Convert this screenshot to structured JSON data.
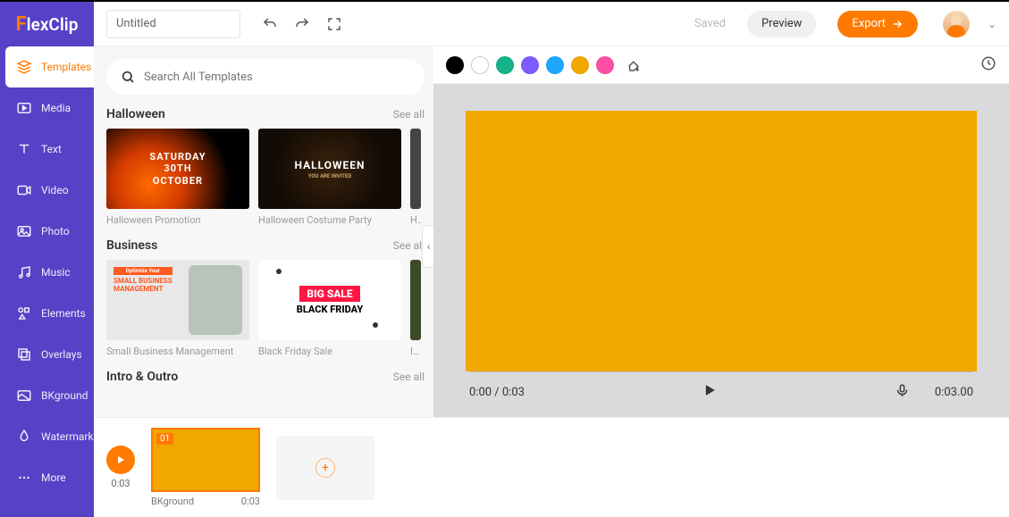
{
  "logo": "lexClip",
  "sidebar": {
    "items": [
      {
        "label": "Templates"
      },
      {
        "label": "Media"
      },
      {
        "label": "Text"
      },
      {
        "label": "Video"
      },
      {
        "label": "Photo"
      },
      {
        "label": "Music"
      },
      {
        "label": "Elements"
      },
      {
        "label": "Overlays"
      },
      {
        "label": "BKground"
      },
      {
        "label": "Watermark"
      },
      {
        "label": "More"
      }
    ]
  },
  "topbar": {
    "title": "Untitled",
    "saved": "Saved",
    "preview": "Preview",
    "export": "Export"
  },
  "search": {
    "placeholder": "Search All Templates"
  },
  "sections": {
    "halloween": {
      "title": "Halloween",
      "seeall": "See all",
      "cards": [
        {
          "label": "Halloween Promotion",
          "line1": "SATURDAY",
          "line2": "30TH",
          "line3": "OCTOBER"
        },
        {
          "label": "Halloween Costume Party",
          "line1": "HALLOWEEN",
          "line2": "YOU ARE INVITED"
        },
        {
          "label": "Hal"
        }
      ]
    },
    "business": {
      "title": "Business",
      "seeall": "See all",
      "cards": [
        {
          "label": "Small Business Management",
          "tag": "Optimize Your",
          "line1": "SMALL BUSINESS",
          "line2": "MANAGEMENT"
        },
        {
          "label": "Black Friday Sale",
          "line1": "BIG SALE",
          "line2": "BLACK FRIDAY"
        },
        {
          "label": "Int"
        }
      ]
    },
    "intro": {
      "title": "Intro & Outro",
      "seeall": "See all"
    }
  },
  "colors": [
    "#000000",
    "#ffffff",
    "#14b18a",
    "#7c5cff",
    "#1ea7ff",
    "#f0a800",
    "#ff4fa3"
  ],
  "transport": {
    "time": "0:00 / 0:03",
    "duration": "0:03.00"
  },
  "timeline": {
    "play_time": "0:03",
    "clip_badge": "01",
    "clip_label": "BKground",
    "clip_time": "0:03"
  }
}
